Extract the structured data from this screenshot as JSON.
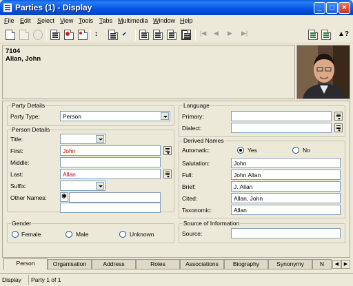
{
  "window": {
    "title": "Parties (1) - Display"
  },
  "menu": [
    "File",
    "Edit",
    "Select",
    "View",
    "Tools",
    "Tabs",
    "Multimedia",
    "Window",
    "Help"
  ],
  "header": {
    "code": "7104",
    "name": "Allan, John"
  },
  "party_details": {
    "legend": "Party Details",
    "party_type_label": "Party Type:",
    "party_type_value": "Person"
  },
  "person_details": {
    "legend": "Person Details",
    "title_label": "Title:",
    "title_value": "",
    "first_label": "First:",
    "first_value": "John",
    "middle_label": "Middle:",
    "middle_value": "",
    "last_label": "Last:",
    "last_value": "Allan",
    "suffix_label": "Suffix:",
    "suffix_value": "",
    "other_names_label": "Other Names:",
    "other_names_value": ""
  },
  "gender": {
    "legend": "Gender",
    "options": [
      "Female",
      "Male",
      "Unknown"
    ],
    "selected": ""
  },
  "language": {
    "legend": "Language",
    "primary_label": "Primary:",
    "primary_value": "",
    "dialect_label": "Dialect:",
    "dialect_value": ""
  },
  "derived_names": {
    "legend": "Derived Names",
    "automatic_label": "Automatic:",
    "yes_label": "Yes",
    "no_label": "No",
    "automatic_selected": "Yes",
    "salutation_label": "Salutation:",
    "salutation_value": "John",
    "full_label": "Full:",
    "full_value": "John Allan",
    "brief_label": "Brief:",
    "brief_value": "J. Allan",
    "cited_label": "Cited:",
    "cited_value": "Allan, John",
    "taxonomic_label": "Taxonomic:",
    "taxonomic_value": "Allan"
  },
  "source": {
    "legend": "Source of Information",
    "source_label": "Source:",
    "source_value": ""
  },
  "tabs": [
    "Person",
    "Organisation",
    "Address",
    "Roles",
    "Associations",
    "Biography",
    "Synonymy",
    "N"
  ],
  "active_tab": "Person",
  "status": {
    "mode": "Display",
    "record": "Party 1 of 1"
  },
  "colors": {
    "title_bar": "#0054e3",
    "required_text": "#cc0000",
    "window_bg": "#ece9d8"
  }
}
